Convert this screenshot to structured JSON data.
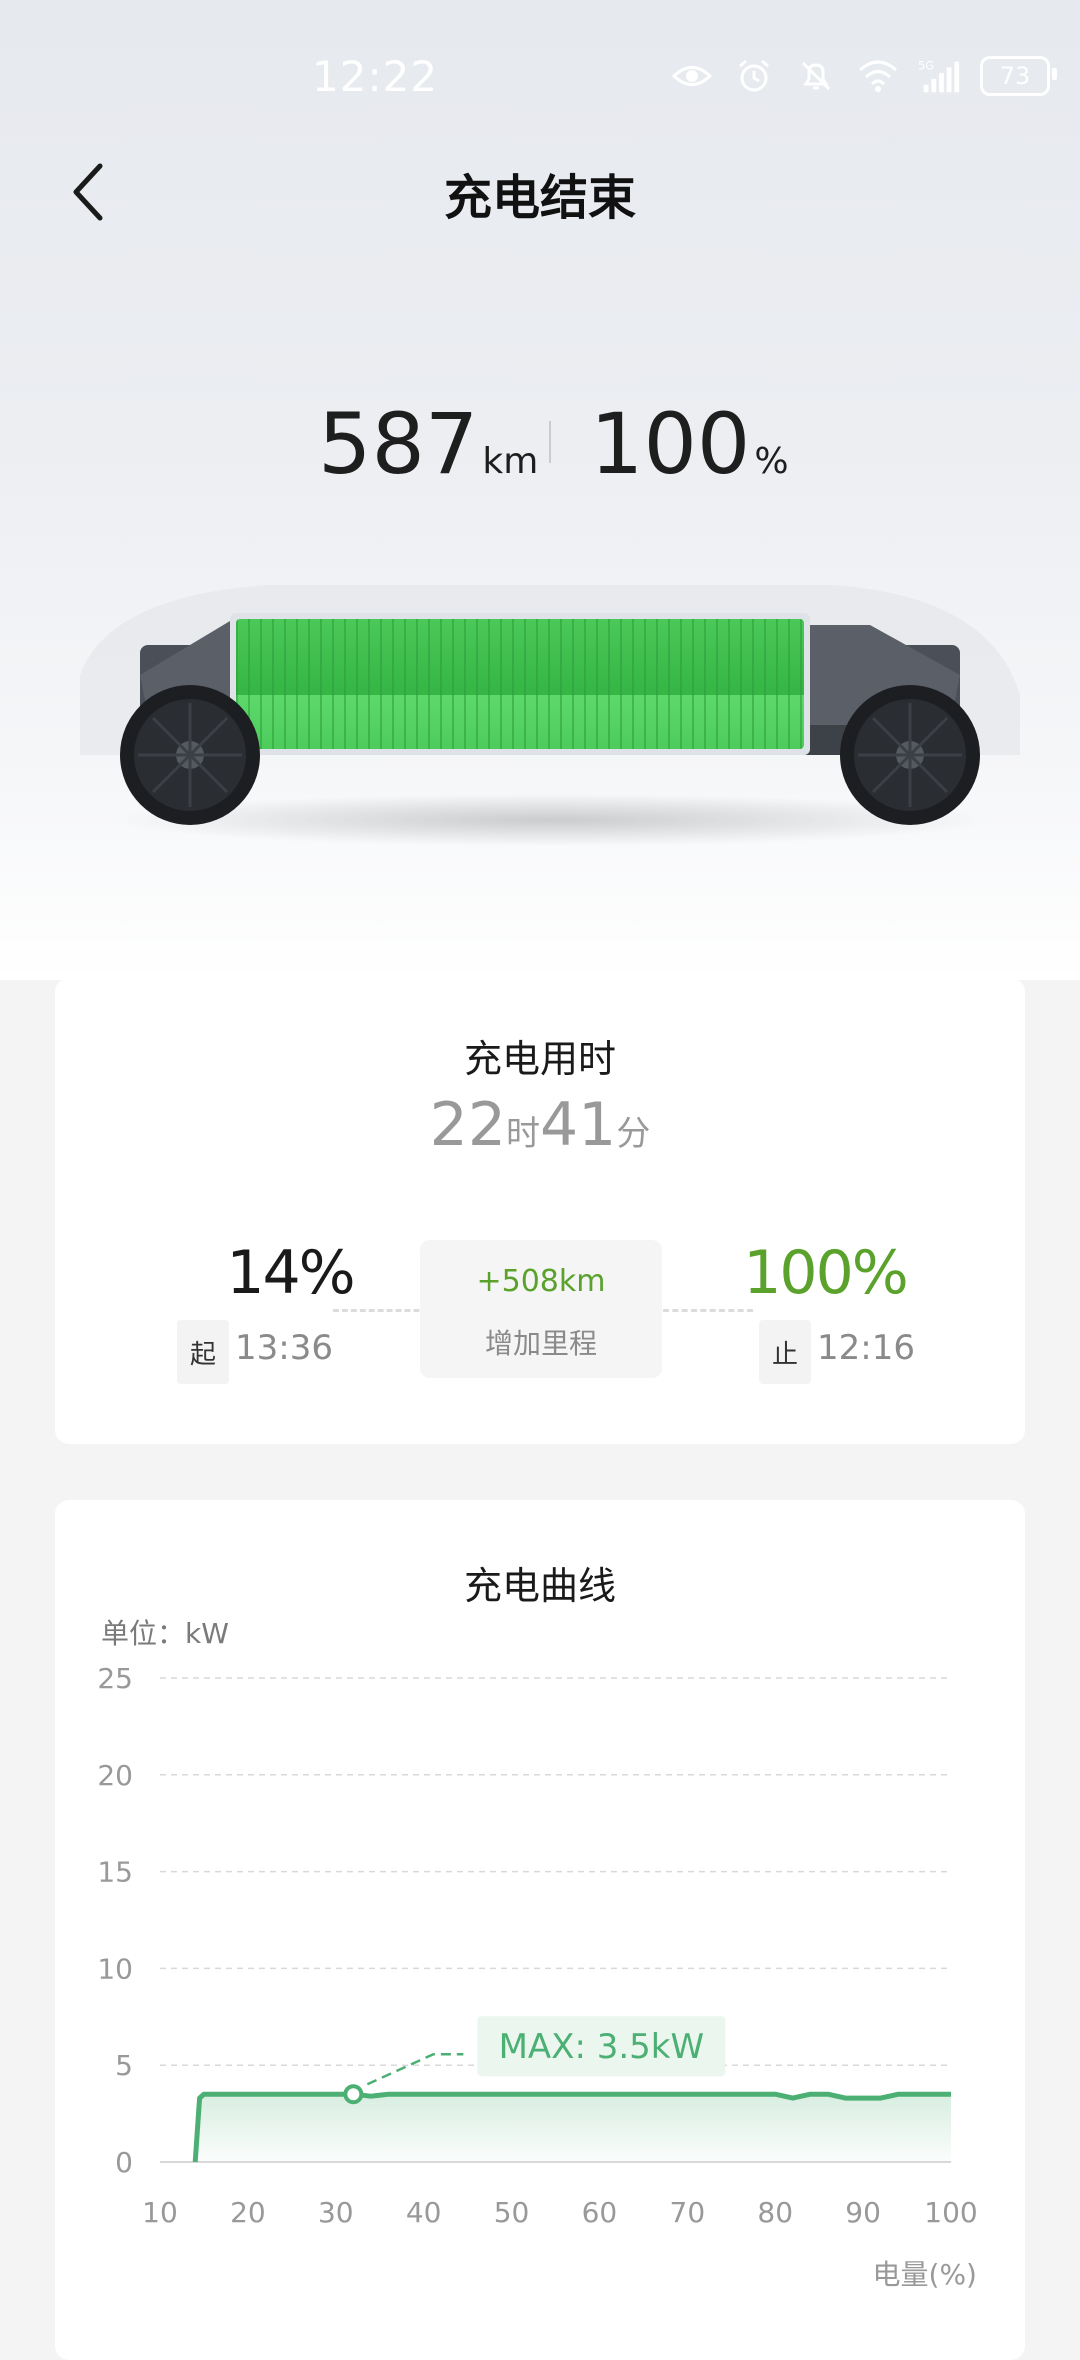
{
  "status_bar": {
    "time": "12:22",
    "icons": [
      "eye-icon",
      "alarm-icon",
      "mute-icon",
      "wifi-icon",
      "signal-5g-icon"
    ],
    "battery": "73"
  },
  "header": {
    "title": "充电结束",
    "back_icon": "chevron-left-icon"
  },
  "summary": {
    "range_value": "587",
    "range_unit": "km",
    "soc_value": "100",
    "soc_unit": "%"
  },
  "colors": {
    "accent_green": "#5aa22c",
    "chart_green": "#4caf74",
    "battery_green": "#4cd05a"
  },
  "charge_time_card": {
    "title": "充电用时",
    "hours": "22",
    "hours_unit": "时",
    "minutes": "41",
    "minutes_unit": "分",
    "start_soc": "14%",
    "start_tag": "起",
    "start_time": "13:36",
    "end_soc": "100%",
    "end_tag": "止",
    "end_time": "12:16",
    "added_range": "+508km",
    "added_range_label": "增加里程"
  },
  "chart_card": {
    "title": "充电曲线",
    "unit_label": "单位：kW",
    "max_label": "MAX: 3.5kW"
  },
  "chart_data": {
    "type": "area",
    "title": "充电曲线",
    "ylabel": "单位：kW",
    "xlabel": "电量(%)",
    "x_ticks": [
      10,
      20,
      30,
      40,
      50,
      60,
      70,
      80,
      90,
      100
    ],
    "y_ticks": [
      0,
      5,
      10,
      15,
      20,
      25
    ],
    "xlim": [
      10,
      100
    ],
    "ylim": [
      0,
      25
    ],
    "grid": true,
    "series": [
      {
        "x": [
          14,
          14.5,
          15,
          20,
          30,
          32,
          34,
          36,
          40,
          50,
          60,
          70,
          80,
          82,
          84,
          86,
          88,
          90,
          92,
          94,
          100
        ],
        "y": [
          0,
          3.3,
          3.5,
          3.5,
          3.5,
          3.5,
          3.4,
          3.5,
          3.5,
          3.5,
          3.5,
          3.5,
          3.5,
          3.3,
          3.5,
          3.5,
          3.3,
          3.3,
          3.3,
          3.5,
          3.5
        ]
      }
    ],
    "marker": {
      "x": 32,
      "y": 3.5
    },
    "annotation": "MAX: 3.5kW"
  }
}
